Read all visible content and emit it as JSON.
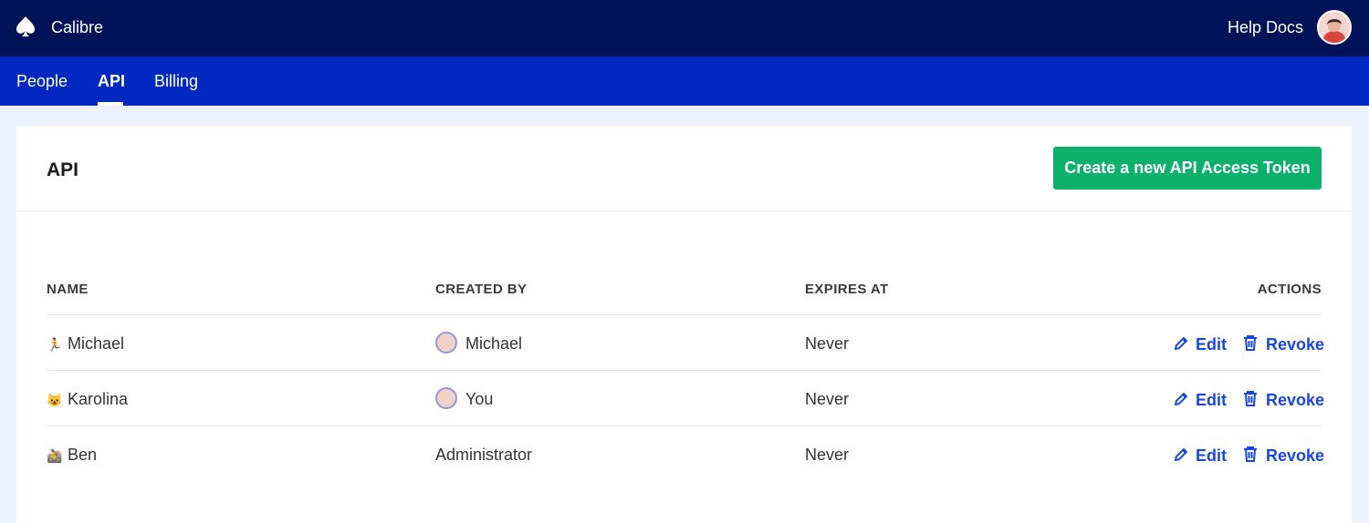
{
  "app": {
    "name": "Calibre",
    "logo_icon": "spade-icon",
    "help_label": "Help Docs",
    "user_avatar_icon": "user-avatar-icon"
  },
  "tabs": [
    {
      "label": "People",
      "active": false
    },
    {
      "label": "API",
      "active": true
    },
    {
      "label": "Billing",
      "active": false
    }
  ],
  "page": {
    "title": "API",
    "create_button_label": "Create a new API Access Token"
  },
  "table": {
    "columns": [
      "NAME",
      "CREATED BY",
      "EXPIRES AT",
      "ACTIONS"
    ],
    "rows": [
      {
        "name_emoji": "🏃",
        "name": "Michael",
        "created_by": "Michael",
        "created_by_avatar": true,
        "expires": "Never",
        "edit_label": "Edit",
        "revoke_label": "Revoke"
      },
      {
        "name_emoji": "😺",
        "name": "Karolina",
        "created_by": "You",
        "created_by_avatar": true,
        "expires": "Never",
        "edit_label": "Edit",
        "revoke_label": "Revoke"
      },
      {
        "name_emoji": "🚵",
        "name": "Ben",
        "created_by": "Administrator",
        "created_by_avatar": false,
        "expires": "Never",
        "edit_label": "Edit",
        "revoke_label": "Revoke"
      }
    ]
  },
  "colors": {
    "topbar": "#001358",
    "subnav": "#0129c2",
    "background": "#eef2ff",
    "primary_button": "#0bb06a",
    "action_link": "#1846e0"
  }
}
